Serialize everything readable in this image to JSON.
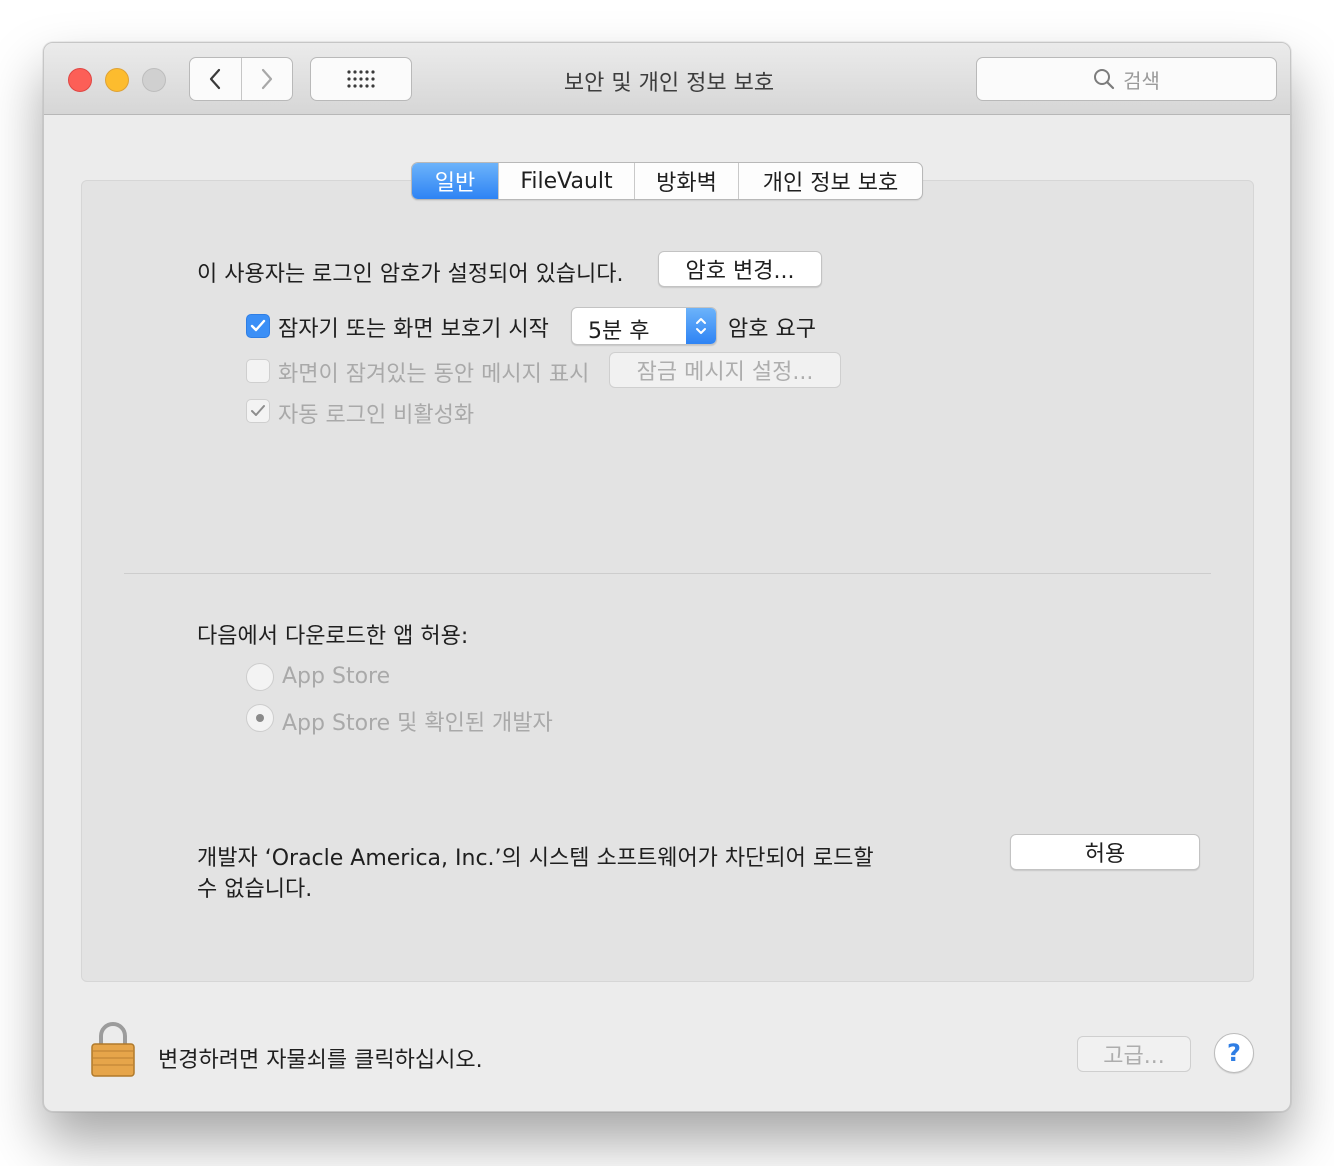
{
  "window": {
    "title": "보안 및 개인 정보 보호",
    "search_placeholder": "검색"
  },
  "tabs": [
    {
      "label": "일반",
      "active": true
    },
    {
      "label": "FileVault",
      "active": false
    },
    {
      "label": "방화벽",
      "active": false
    },
    {
      "label": "개인 정보 보호",
      "active": false
    }
  ],
  "general": {
    "password_status": "이 사용자는 로그인 암호가 설정되어 있습니다.",
    "change_password_button": "암호 변경...",
    "require_password": {
      "checked": true,
      "label": "잠자기 또는 화면 보호기 시작",
      "delay_value": "5분 후",
      "suffix": "암호 요구"
    },
    "show_message": {
      "checked": false,
      "enabled": false,
      "label": "화면이 잠겨있는 동안 메시지 표시",
      "button": "잠금 메시지 설정..."
    },
    "disable_autologin": {
      "checked": true,
      "enabled": false,
      "label": "자동 로그인 비활성화"
    }
  },
  "downloads": {
    "heading": "다음에서 다운로드한 앱 허용:",
    "options": [
      {
        "label": "App Store",
        "selected": false
      },
      {
        "label": "App Store 및 확인된 개발자",
        "selected": true
      }
    ]
  },
  "blocked": {
    "message_line1": "개발자 ‘Oracle America, Inc.’의 시스템 소프트웨어가 차단되어 로드할",
    "message_line2": "수 없습니다.",
    "allow_button": "허용"
  },
  "footer": {
    "lock_text": "변경하려면 자물쇠를 클릭하십시오.",
    "advanced_button": "고급...",
    "help_label": "?"
  },
  "colors": {
    "accent": "#3b8ff6",
    "close": "#fc5f57",
    "minimize": "#fdbc2e",
    "lock_body": "#e6a54a"
  },
  "icons": [
    "close-button",
    "minimize-button",
    "zoom-button",
    "back-arrow-icon",
    "forward-arrow-icon",
    "grid-icon",
    "search-icon",
    "checkmark-icon",
    "updown-arrows-icon",
    "lock-icon",
    "help-icon"
  ]
}
